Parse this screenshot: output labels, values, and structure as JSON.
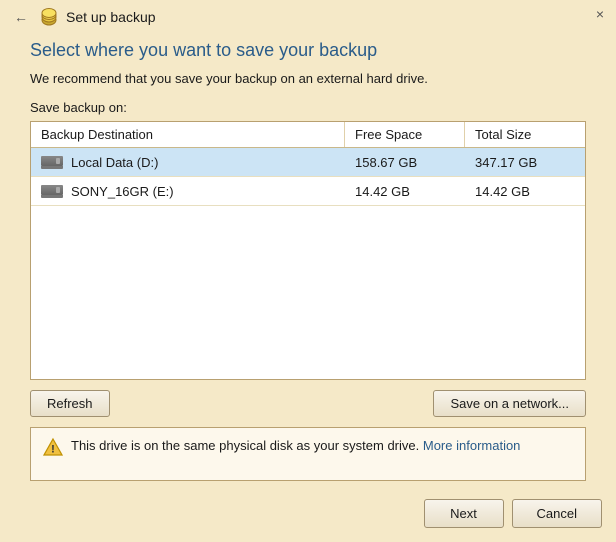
{
  "window": {
    "title": "Set up backup",
    "close_label": "×"
  },
  "heading": "Select where you want to save your backup",
  "subtext": "We recommend that you save your backup on an external hard drive.",
  "save_label": "Save backup on:",
  "table": {
    "columns": [
      {
        "label": "Backup Destination"
      },
      {
        "label": "Free Space"
      },
      {
        "label": "Total Size"
      }
    ],
    "rows": [
      {
        "name": "Local Data (D:)",
        "free_space": "158.67 GB",
        "total_size": "347.17 GB"
      },
      {
        "name": "SONY_16GR (E:)",
        "free_space": "14.42 GB",
        "total_size": "14.42 GB"
      }
    ]
  },
  "buttons": {
    "refresh": "Refresh",
    "save_network": "Save on a network...",
    "next": "Next",
    "cancel": "Cancel"
  },
  "warning": {
    "text": "This drive is on the same physical disk as your system drive.",
    "link_text": "More information"
  }
}
